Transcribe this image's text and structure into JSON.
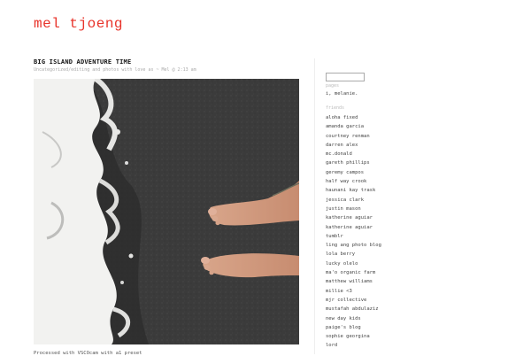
{
  "site": {
    "title": "mel tjoeng"
  },
  "post": {
    "title": "BIG ISLAND ADVENTURE TIME",
    "meta": "Uncategorized/editing and photos with love as ~ Mel @ 2:13 am",
    "caption": "Processed with VSCOcam with a1 preset"
  },
  "sidebar": {
    "search_placeholder": "",
    "pages_label": "pages",
    "pages": [
      "i, melanie."
    ],
    "friends_label": "friends",
    "friends": [
      "aloha fixed",
      "amanda garcia",
      "courtney renman",
      "darren alex",
      "mc.donald",
      "gareth phillips",
      "geremy campos",
      "half way crook",
      "haunani kay trask",
      "jessica clark",
      "justin mason",
      "katherine aguiar",
      "katherine aguiar",
      "tumblr",
      "ling ang photo blog",
      "lola berry",
      "lucky olelo",
      "ma'o organic farm",
      "matthew williams",
      "millie <3",
      "mjr collective",
      "mustafah abdulaziz",
      "new day kids",
      "paige's blog",
      "sophie georgina",
      "lord"
    ]
  },
  "colors": {
    "title_red": "#e8332a",
    "sand": "#3a3a3a",
    "foam": "#f2f2f0"
  }
}
